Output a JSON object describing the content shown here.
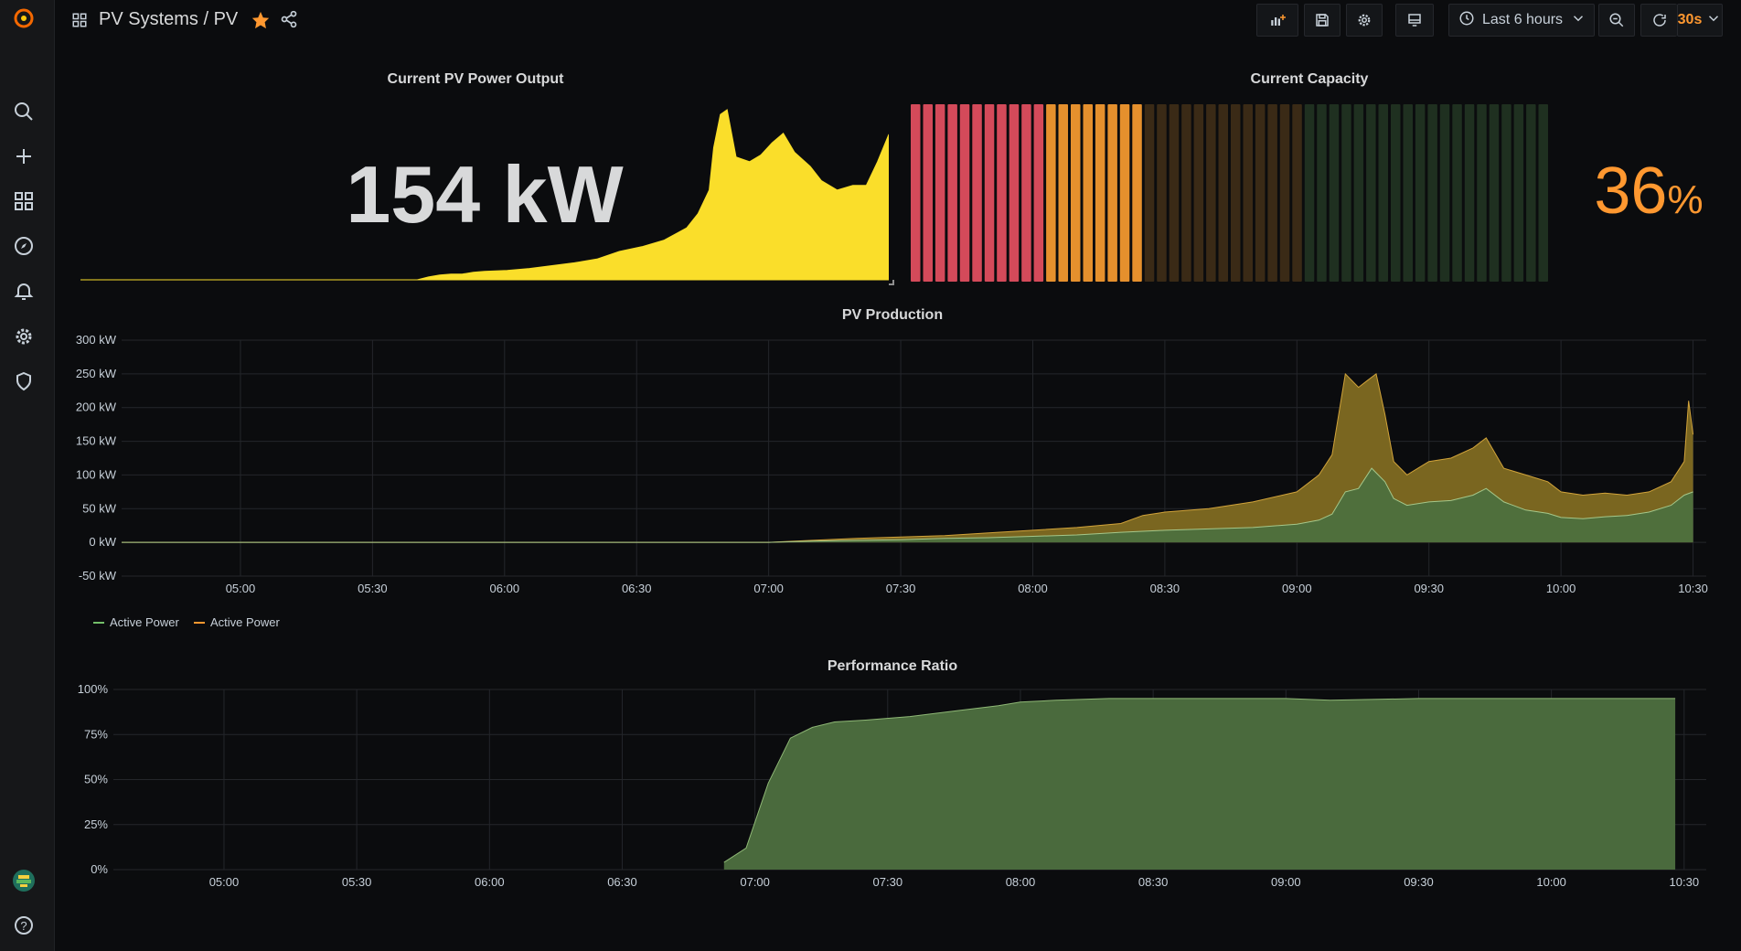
{
  "topbar": {
    "breadcrumb": "PV Systems / PV",
    "time_range": "Last 6 hours",
    "refresh_interval": "30s"
  },
  "panels": {
    "power_output": {
      "title": "Current PV Power Output",
      "value": "154",
      "unit": "kW"
    },
    "capacity": {
      "title": "Current Capacity",
      "value": "36",
      "unit": "%",
      "color": "#ff9830",
      "bars_total": 52,
      "bars_red": 11,
      "bars_orange": 8,
      "bars_dim_orange": 13,
      "bars_dim_green": 20
    },
    "pv_production": {
      "title": "PV Production",
      "legend": [
        {
          "label": "Active Power",
          "color": "#73bf69"
        },
        {
          "label": "Active Power",
          "color": "#ff9830"
        }
      ]
    },
    "performance_ratio": {
      "title": "Performance Ratio"
    }
  },
  "chart_data": [
    {
      "type": "area",
      "title": "Current PV Power Output",
      "note_sparkline": true,
      "x": [
        "04:30",
        "04:45",
        "05:00",
        "05:15",
        "05:30",
        "05:45",
        "06:00",
        "06:15",
        "06:30",
        "06:45",
        "07:00",
        "07:05",
        "07:10",
        "07:15",
        "07:20",
        "07:25",
        "07:30",
        "07:40",
        "07:50",
        "08:00",
        "08:10",
        "08:20",
        "08:30",
        "08:40",
        "08:50",
        "09:00",
        "09:05",
        "09:10",
        "09:12",
        "09:15",
        "09:18",
        "09:22",
        "09:28",
        "09:33",
        "09:38",
        "09:43",
        "09:48",
        "09:55",
        "10:00",
        "10:07",
        "10:14",
        "10:20",
        "10:25",
        "10:30"
      ],
      "values": [
        0,
        0,
        0,
        0,
        0,
        0,
        0,
        0,
        0,
        0,
        0,
        3,
        5,
        6,
        6,
        8,
        9,
        10,
        12,
        15,
        18,
        22,
        30,
        35,
        42,
        55,
        70,
        95,
        140,
        175,
        180,
        130,
        125,
        132,
        145,
        155,
        135,
        120,
        105,
        95,
        100,
        100,
        125,
        154
      ]
    },
    {
      "type": "area",
      "title": "PV Production",
      "ylim": [
        -50,
        300
      ],
      "y_ticks": [
        "-50 kW",
        "0 kW",
        "50 kW",
        "100 kW",
        "150 kW",
        "200 kW",
        "250 kW",
        "300 kW"
      ],
      "x_ticks": [
        "05:00",
        "05:30",
        "06:00",
        "06:30",
        "07:00",
        "07:30",
        "08:00",
        "08:30",
        "09:00",
        "09:30",
        "10:00",
        "10:30"
      ],
      "series": [
        {
          "name": "Active Power",
          "color": "#73bf69",
          "x": [
            "04:33",
            "07:00",
            "07:10",
            "07:20",
            "07:30",
            "07:40",
            "07:50",
            "08:00",
            "08:10",
            "08:20",
            "08:30",
            "08:40",
            "08:50",
            "09:00",
            "09:05",
            "09:08",
            "09:11",
            "09:14",
            "09:17",
            "09:20",
            "09:22",
            "09:25",
            "09:30",
            "09:35",
            "09:40",
            "09:43",
            "09:47",
            "09:52",
            "09:57",
            "10:00",
            "10:05",
            "10:10",
            "10:15",
            "10:20",
            "10:25",
            "10:28",
            "10:30"
          ],
          "values": [
            0,
            0,
            2,
            3,
            4,
            6,
            7,
            9,
            11,
            15,
            18,
            20,
            22,
            27,
            33,
            42,
            75,
            80,
            110,
            90,
            65,
            55,
            60,
            62,
            70,
            80,
            60,
            48,
            43,
            37,
            35,
            38,
            40,
            45,
            55,
            70,
            75
          ]
        },
        {
          "name": "Active Power",
          "color": "#ff9830",
          "x": [
            "04:33",
            "07:00",
            "07:10",
            "07:20",
            "07:30",
            "07:40",
            "07:50",
            "08:00",
            "08:10",
            "08:20",
            "08:25",
            "08:30",
            "08:40",
            "08:50",
            "09:00",
            "09:05",
            "09:08",
            "09:11",
            "09:14",
            "09:16",
            "09:18",
            "09:20",
            "09:22",
            "09:25",
            "09:30",
            "09:35",
            "09:40",
            "09:43",
            "09:47",
            "09:52",
            "09:57",
            "10:00",
            "10:05",
            "10:10",
            "10:15",
            "10:20",
            "10:25",
            "10:28",
            "10:29",
            "10:30"
          ],
          "values": [
            0,
            0,
            3,
            6,
            8,
            10,
            14,
            18,
            22,
            28,
            40,
            45,
            50,
            60,
            75,
            100,
            130,
            250,
            230,
            240,
            250,
            190,
            120,
            100,
            120,
            125,
            140,
            155,
            110,
            100,
            90,
            75,
            70,
            73,
            70,
            75,
            90,
            120,
            210,
            160
          ]
        }
      ]
    },
    {
      "type": "area",
      "title": "Performance Ratio",
      "ylim": [
        0,
        100
      ],
      "y_ticks": [
        "0%",
        "25%",
        "50%",
        "75%",
        "100%"
      ],
      "x_ticks": [
        "05:00",
        "05:30",
        "06:00",
        "06:30",
        "07:00",
        "07:30",
        "08:00",
        "08:30",
        "09:00",
        "09:30",
        "10:00",
        "10:30"
      ],
      "series": [
        {
          "color": "#73bf69",
          "x": [
            "06:53",
            "06:58",
            "07:03",
            "07:08",
            "07:13",
            "07:18",
            "07:25",
            "07:35",
            "07:45",
            "07:55",
            "08:00",
            "08:08",
            "08:20",
            "08:40",
            "09:00",
            "09:10",
            "09:30",
            "10:00",
            "10:20",
            "10:28"
          ],
          "values": [
            4,
            12,
            48,
            73,
            79,
            82,
            83,
            85,
            88,
            91,
            93,
            94,
            95,
            95,
            95,
            94,
            95,
            95,
            95,
            95
          ]
        }
      ]
    }
  ]
}
